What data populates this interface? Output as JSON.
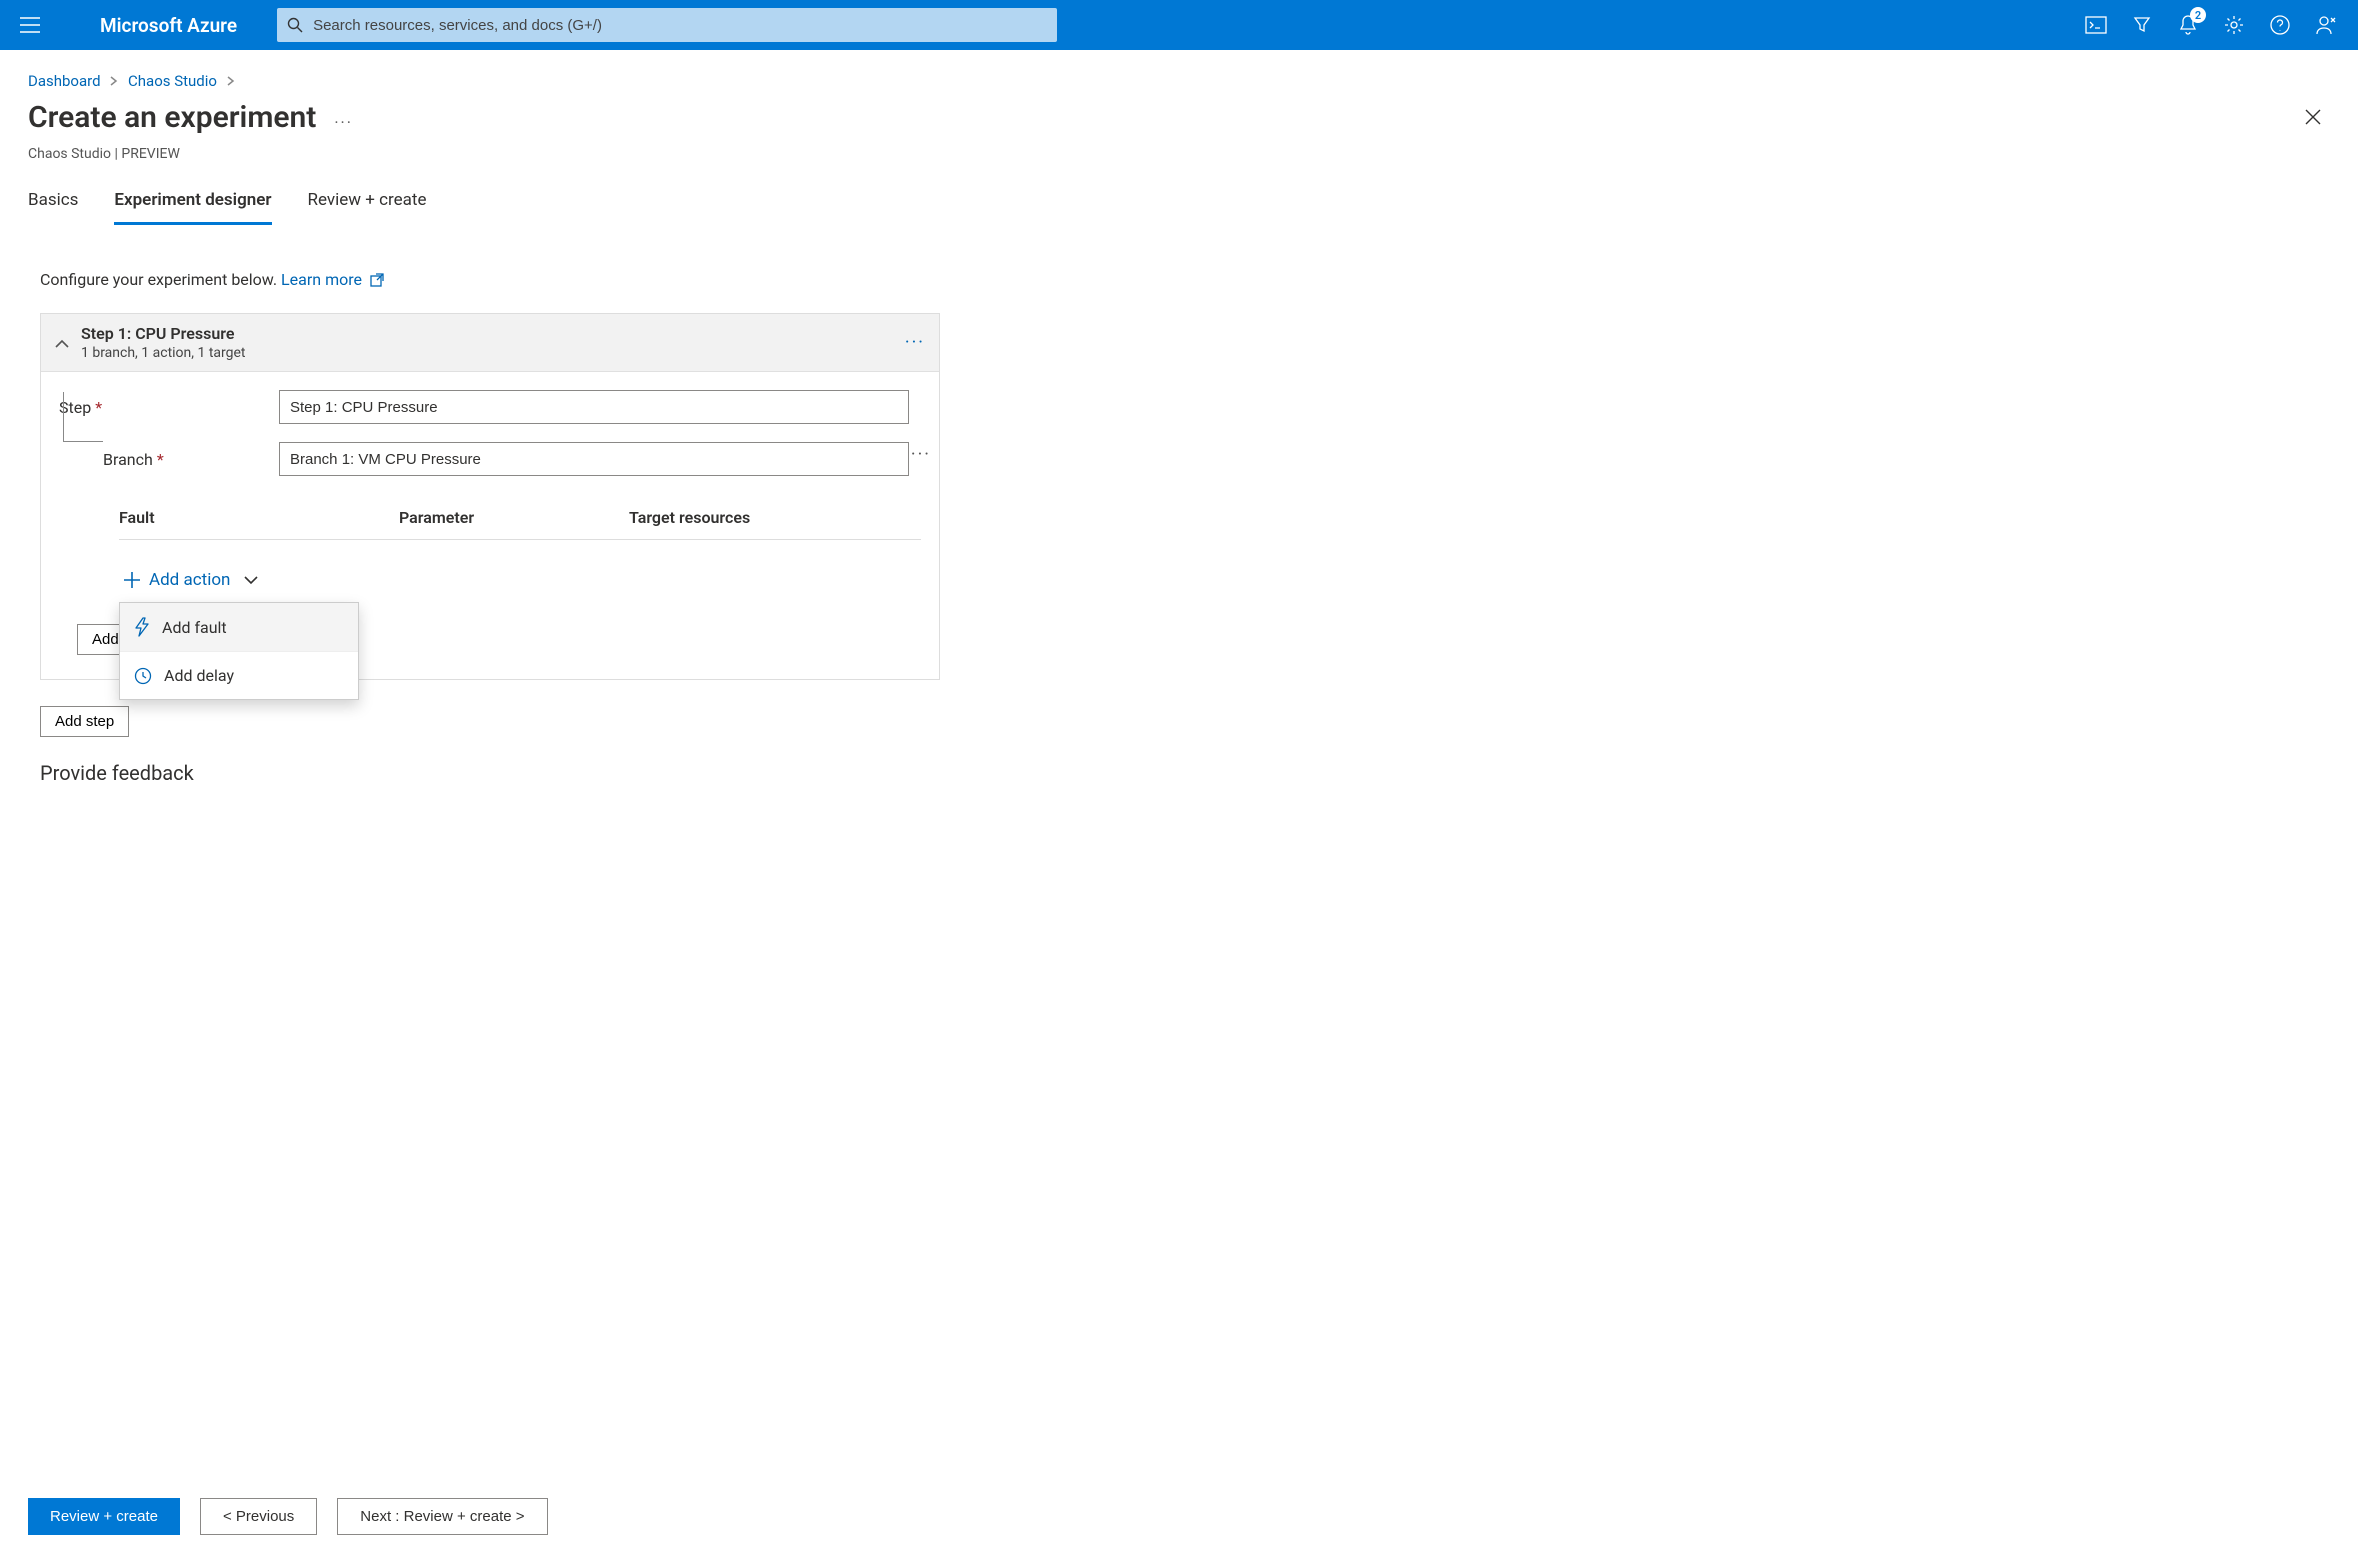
{
  "topbar": {
    "brand": "Microsoft Azure",
    "search_placeholder": "Search resources, services, and docs (G+/)",
    "notification_count": "2"
  },
  "breadcrumb": {
    "items": [
      "Dashboard",
      "Chaos Studio"
    ]
  },
  "page": {
    "title": "Create an experiment",
    "subtitle": "Chaos Studio | PREVIEW"
  },
  "tabs": {
    "items": [
      "Basics",
      "Experiment designer",
      "Review + create"
    ],
    "active_index": 1
  },
  "designer": {
    "intro": "Configure your experiment below.",
    "learn_more": "Learn more",
    "step": {
      "title": "Step 1: CPU Pressure",
      "summary": "1 branch, 1 action, 1 target",
      "step_label": "Step",
      "step_value": "Step 1: CPU Pressure",
      "branch_label": "Branch",
      "branch_value": "Branch 1: VM CPU Pressure",
      "fault_headers": {
        "fault": "Fault",
        "parameter": "Parameter",
        "target": "Target resources"
      },
      "add_action_label": "Add action",
      "dropdown": {
        "add_fault": "Add fault",
        "add_delay": "Add delay"
      },
      "add_branch_btn": "Add",
      "add_step_btn": "Add step"
    },
    "feedback_heading": "Provide feedback"
  },
  "footer": {
    "review_create": "Review + create",
    "previous": "< Previous",
    "next": "Next : Review + create >"
  }
}
